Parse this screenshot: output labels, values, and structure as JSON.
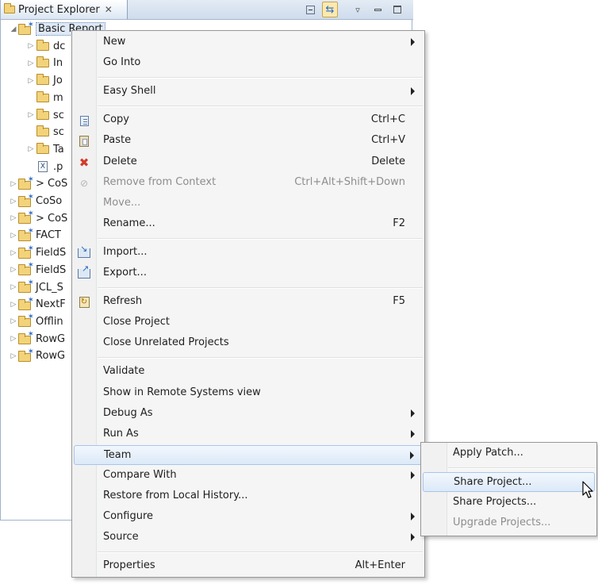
{
  "view": {
    "title": "Project Explorer",
    "close_glyph": "✕"
  },
  "tree": {
    "items": [
      {
        "label": "Basic Report",
        "indent": 0,
        "expanded": true,
        "kind": "project",
        "selected": true
      },
      {
        "label": "dc",
        "indent": 1,
        "expanded": false,
        "kind": "folder"
      },
      {
        "label": "In",
        "indent": 1,
        "expanded": false,
        "kind": "folder"
      },
      {
        "label": "Jo",
        "indent": 1,
        "expanded": false,
        "kind": "folder"
      },
      {
        "label": "m",
        "indent": 1,
        "expanded": null,
        "kind": "folder"
      },
      {
        "label": "sc",
        "indent": 1,
        "expanded": false,
        "kind": "folder"
      },
      {
        "label": "sc",
        "indent": 1,
        "expanded": null,
        "kind": "folder"
      },
      {
        "label": "Ta",
        "indent": 1,
        "expanded": false,
        "kind": "folder"
      },
      {
        "label": ".p",
        "indent": 1,
        "expanded": null,
        "kind": "xfile"
      },
      {
        "label": "> CoS",
        "indent": 0,
        "expanded": false,
        "kind": "project"
      },
      {
        "label": "CoSo",
        "indent": 0,
        "expanded": false,
        "kind": "project"
      },
      {
        "label": "> CoS",
        "indent": 0,
        "expanded": false,
        "kind": "project"
      },
      {
        "label": "FACT",
        "indent": 0,
        "expanded": false,
        "kind": "project"
      },
      {
        "label": "FieldS",
        "indent": 0,
        "expanded": false,
        "kind": "project"
      },
      {
        "label": "FieldS",
        "indent": 0,
        "expanded": false,
        "kind": "project"
      },
      {
        "label": "JCL_S",
        "indent": 0,
        "expanded": false,
        "kind": "project"
      },
      {
        "label": "NextF",
        "indent": 0,
        "expanded": false,
        "kind": "project"
      },
      {
        "label": "Offlin",
        "indent": 0,
        "expanded": false,
        "kind": "project"
      },
      {
        "label": "RowG",
        "indent": 0,
        "expanded": false,
        "kind": "project"
      },
      {
        "label": "RowG",
        "indent": 0,
        "expanded": false,
        "kind": "project"
      }
    ]
  },
  "menu": {
    "groups": [
      [
        {
          "label": "New",
          "submenu": true
        },
        {
          "label": "Go Into"
        }
      ],
      [
        {
          "label": "Easy Shell",
          "submenu": true
        }
      ],
      [
        {
          "label": "Copy",
          "shortcut": "Ctrl+C",
          "icon": "copy-icon"
        },
        {
          "label": "Paste",
          "shortcut": "Ctrl+V",
          "icon": "paste-icon"
        },
        {
          "label": "Delete",
          "shortcut": "Delete",
          "icon": "delete-icon"
        },
        {
          "label": "Remove from Context",
          "shortcut": "Ctrl+Alt+Shift+Down",
          "icon": "remove-context-icon",
          "disabled": true
        },
        {
          "label": "Move...",
          "disabled": true
        },
        {
          "label": "Rename...",
          "shortcut": "F2"
        }
      ],
      [
        {
          "label": "Import...",
          "icon": "import-icon"
        },
        {
          "label": "Export...",
          "icon": "export-icon"
        }
      ],
      [
        {
          "label": "Refresh",
          "shortcut": "F5",
          "icon": "refresh-icon"
        },
        {
          "label": "Close Project"
        },
        {
          "label": "Close Unrelated Projects"
        }
      ],
      [
        {
          "label": "Validate"
        },
        {
          "label": "Show in Remote Systems view"
        },
        {
          "label": "Debug As",
          "submenu": true
        },
        {
          "label": "Run As",
          "submenu": true
        },
        {
          "label": "Team",
          "submenu": true,
          "highlighted": true
        },
        {
          "label": "Compare With",
          "submenu": true
        },
        {
          "label": "Restore from Local History..."
        },
        {
          "label": "Configure",
          "submenu": true
        },
        {
          "label": "Source",
          "submenu": true
        }
      ],
      [
        {
          "label": "Properties",
          "shortcut": "Alt+Enter"
        }
      ]
    ]
  },
  "team_submenu": {
    "groups": [
      [
        {
          "label": "Apply Patch..."
        }
      ],
      [
        {
          "label": "Share Project...",
          "highlighted": true
        },
        {
          "label": "Share Projects..."
        },
        {
          "label": "Upgrade Projects...",
          "disabled": true
        }
      ]
    ]
  },
  "colors": {
    "highlight_border": "#a8c5ea",
    "disabled_text": "#8d8d8d",
    "delete_icon": "#d43a2a"
  }
}
